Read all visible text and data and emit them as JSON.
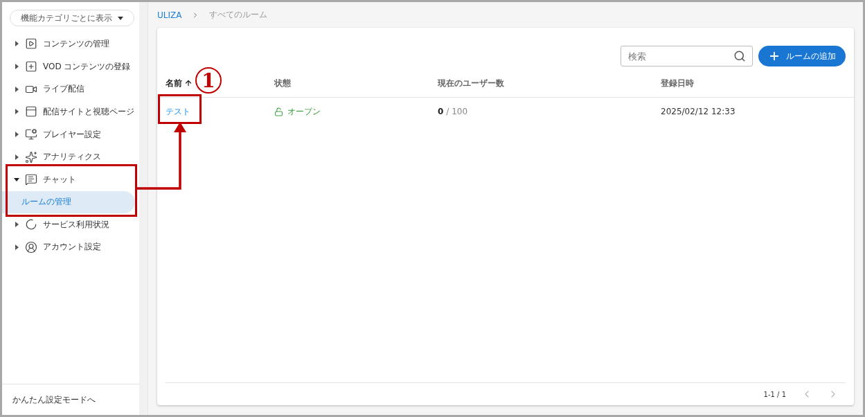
{
  "sidebar": {
    "view_selector": "機能カテゴリごとに表示",
    "items": [
      {
        "label": "コンテンツの管理",
        "expanded": false
      },
      {
        "label": "VOD コンテンツの登録",
        "expanded": false
      },
      {
        "label": "ライブ配信",
        "expanded": false
      },
      {
        "label": "配信サイトと視聴ページ",
        "expanded": false
      },
      {
        "label": "プレイヤー設定",
        "expanded": false
      },
      {
        "label": "アナリティクス",
        "expanded": false
      },
      {
        "label": "チャット",
        "expanded": true,
        "children": [
          {
            "label": "ルームの管理",
            "selected": true
          }
        ]
      },
      {
        "label": "サービス利用状況",
        "expanded": false
      },
      {
        "label": "アカウント設定",
        "expanded": false
      }
    ],
    "footer_link": "かんたん設定モードへ"
  },
  "breadcrumb": [
    "ULIZA",
    "すべてのルーム"
  ],
  "search": {
    "placeholder": "検索"
  },
  "add_button": "ルームの追加",
  "table": {
    "columns": [
      {
        "label": "名前",
        "sorted": true
      },
      {
        "label": "状態",
        "sorted": false
      },
      {
        "label": "現在のユーザー数",
        "sorted": false
      },
      {
        "label": "登録日時",
        "sorted": false
      }
    ],
    "rows": [
      {
        "name": "テスト",
        "status": "オープン",
        "users_current": "0",
        "users_max": "/ 100",
        "created": "2025/02/12 12:33"
      }
    ]
  },
  "pagination": "1-1 / 1",
  "annotation": {
    "number": "1"
  }
}
